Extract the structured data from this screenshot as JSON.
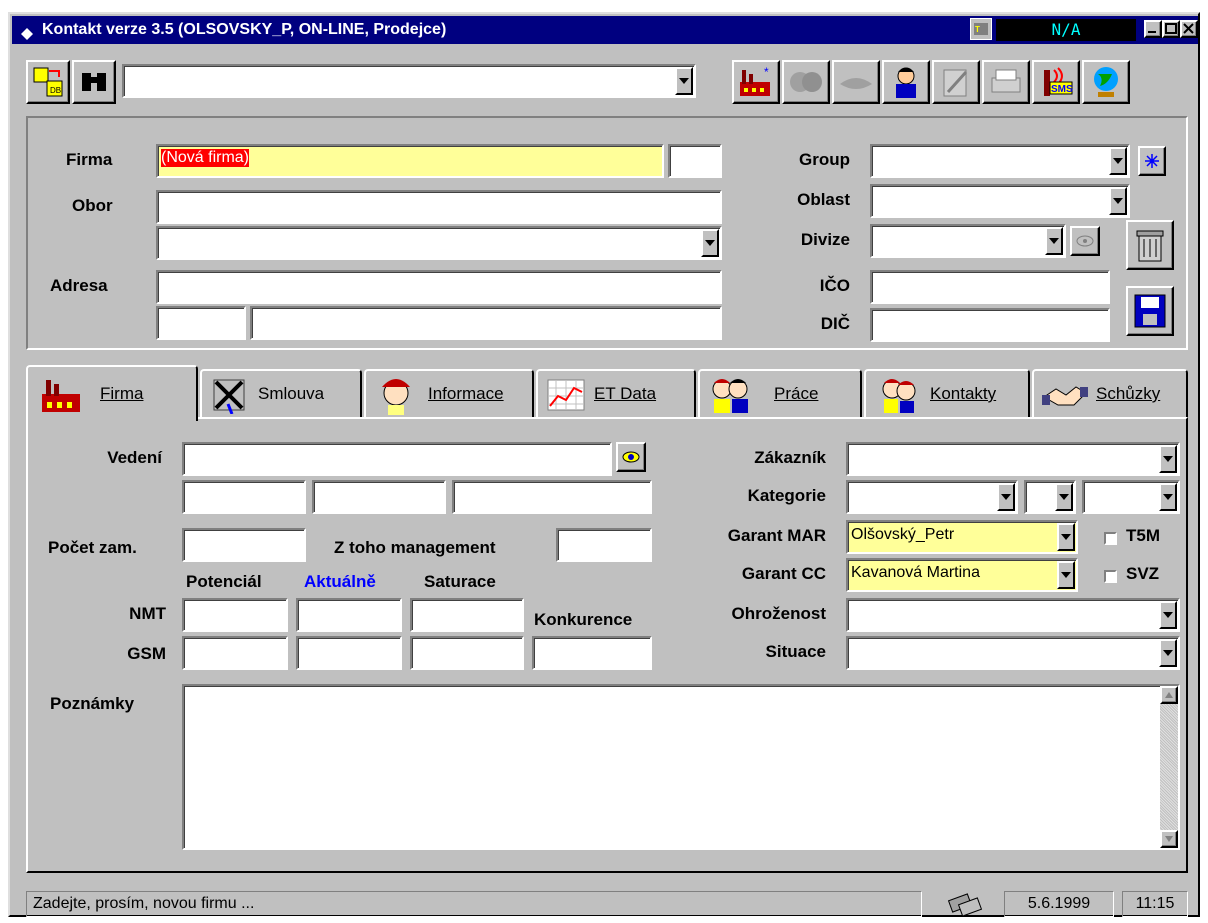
{
  "window": {
    "title": "Kontakt verze 3.5  (OLSOVSKY_P, ON-LINE, Prodejce)",
    "indicator": "N/A"
  },
  "toolbar": {
    "search_value": "",
    "left_icons": [
      "database-sync-icon",
      "binoculars-icon"
    ],
    "right_icons": [
      "factory-new-icon",
      "companies-icon",
      "handshake-icon",
      "person-icon",
      "document-edit-icon",
      "printer-icon",
      "sms-icon",
      "globe-icon"
    ]
  },
  "header": {
    "firma_label": "Firma",
    "firma_value": "(Nová firma)",
    "obor_label": "Obor",
    "adresa_label": "Adresa",
    "group_label": "Group",
    "oblast_label": "Oblast",
    "divize_label": "Divize",
    "ico_label": "IČO",
    "dic_label": "DIČ"
  },
  "tabs": [
    {
      "label": "Firma",
      "icon": "factory-icon",
      "active": true
    },
    {
      "label": "Smlouva",
      "icon": "contract-icon"
    },
    {
      "label": "Informace",
      "icon": "woman-icon"
    },
    {
      "label": "ET Data",
      "icon": "chart-icon"
    },
    {
      "label": "Práce",
      "icon": "workers-icon"
    },
    {
      "label": "Kontakty",
      "icon": "contacts-icon"
    },
    {
      "label": "Schůzky",
      "icon": "handshake-icon"
    }
  ],
  "firma_tab": {
    "vedeni_label": "Vedení",
    "pocet_label": "Počet zam.",
    "management_label": "Z toho management",
    "potencial_label": "Potenciál",
    "aktualne_label": "Aktuálně",
    "saturace_label": "Saturace",
    "konkurence_label": "Konkurence",
    "nmt_label": "NMT",
    "gsm_label": "GSM",
    "poznamky_label": "Poznámky",
    "zakaznik_label": "Zákazník",
    "kategorie_label": "Kategorie",
    "garant_mar_label": "Garant MAR",
    "garant_mar_value": "Olšovský_Petr",
    "garant_cc_label": "Garant CC",
    "garant_cc_value": "Kavanová Martina",
    "ohrozenost_label": "Ohroženost",
    "situace_label": "Situace",
    "t5m_label": "T5M",
    "svz_label": "SVZ"
  },
  "status": {
    "message": "Zadejte, prosím, novou firmu ...",
    "date": "5.6.1999",
    "time": "11:15"
  },
  "colors": {
    "titlebar": "#000080",
    "highlight": "#ffff99",
    "selection": "#ff0000",
    "link": "#0000ff"
  }
}
